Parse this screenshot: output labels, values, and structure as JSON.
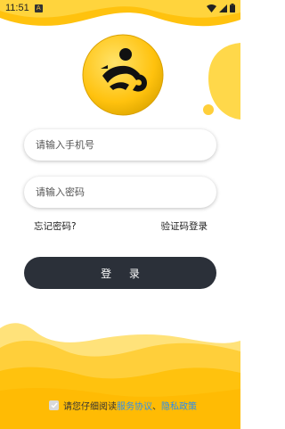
{
  "status": {
    "time": "11:51",
    "notif_glyph": "A"
  },
  "form": {
    "phone_placeholder": "请输入手机号",
    "password_placeholder": "请输入密码",
    "forgot_label": "忘记密码?",
    "sms_login_label": "验证码登录",
    "login_label": "登 录"
  },
  "agreement": {
    "prefix": "请您仔细阅读",
    "service_link": "服务协议",
    "separator": "、",
    "privacy_link": "隐私政策",
    "checked": true
  },
  "colors": {
    "accent": "#ffc20e",
    "button": "#2b3039",
    "link": "#2b8ef0"
  }
}
